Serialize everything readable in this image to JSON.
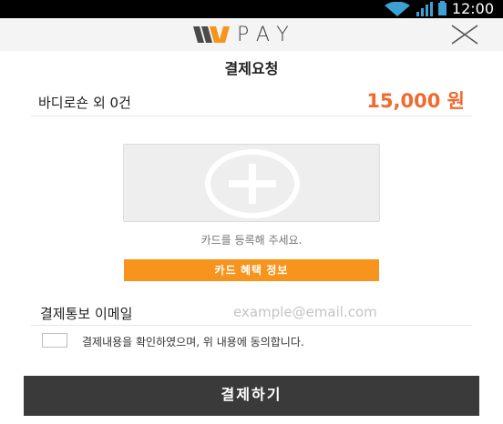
{
  "status_bar": {
    "time": "12:00",
    "icons": [
      "wifi-icon",
      "signal-icon",
      "battery-icon"
    ]
  },
  "header": {
    "logo_text": "PAY",
    "logo_icon": "wpay-w-logo",
    "close_icon": "close-icon"
  },
  "page": {
    "title": "결제요청"
  },
  "order": {
    "product": "바디로숀 외 0건",
    "price": "15,000 원"
  },
  "card": {
    "add_icon": "plus-circle-icon",
    "hint": "카드를 등록해 주세요."
  },
  "benefit_button": "카드 혜택 정보",
  "email": {
    "label": "결제통보 이메일",
    "placeholder": "example@email.com",
    "value": ""
  },
  "agreement": {
    "checked": false,
    "text": "결제내용을 확인하였으며, 위 내용에 동의합니다."
  },
  "pay_button": "결제하기",
  "colors": {
    "accent_orange": "#f7941d",
    "price_color": "#f06a2f",
    "pay_button": "#3a3a3a",
    "logo_w_dark": "#4a4a4a",
    "logo_w_orange": "#f7941d",
    "status_icons": "#3ea1d6"
  }
}
